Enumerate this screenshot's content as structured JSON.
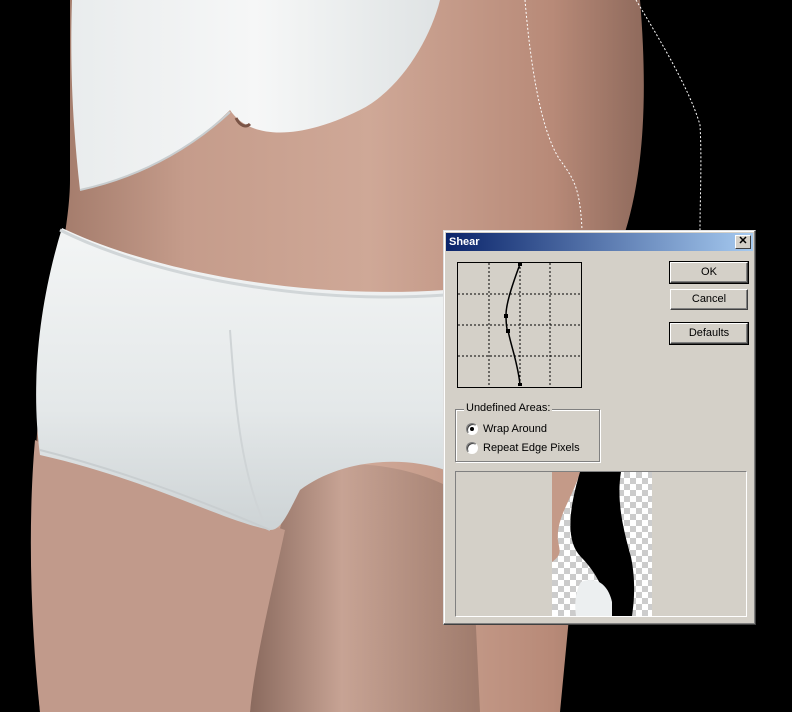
{
  "dialog": {
    "title": "Shear",
    "buttons": {
      "ok": "OK",
      "cancel": "Cancel",
      "defaults": "Defaults"
    },
    "undefined_areas": {
      "legend": "Undefined Areas:",
      "options": [
        {
          "label": "Wrap Around",
          "selected": true
        },
        {
          "label": "Repeat Edge Pixels",
          "selected": false
        }
      ]
    }
  },
  "colors": {
    "dialog_face": "#d4d0c8",
    "title_start": "#0a246a",
    "title_end": "#a6caf0",
    "skin": "#c49a88",
    "garment": "#eceff0",
    "background": "#000000"
  }
}
